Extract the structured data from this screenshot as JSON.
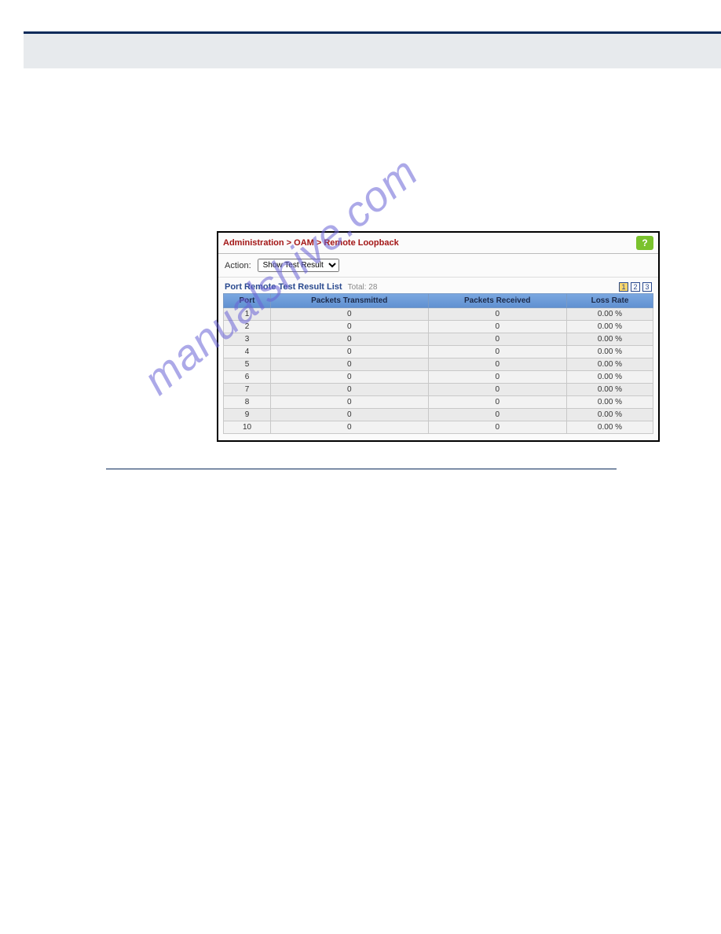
{
  "watermark": "manualshive.com",
  "panel": {
    "breadcrumb": "Administration > OAM > Remote Loopback",
    "help_symbol": "?",
    "action_label": "Action:",
    "action_value": "Show Test Result",
    "list_title": "Port Remote Test Result List",
    "list_total_label": "Total: 28",
    "pager": {
      "pages": [
        "1",
        "2",
        "3"
      ],
      "active_index": 0
    },
    "columns": [
      "Port",
      "Packets Transmitted",
      "Packets Received",
      "Loss Rate"
    ],
    "rows": [
      {
        "port": "1",
        "tx": "0",
        "rx": "0",
        "rate": "0.00 %"
      },
      {
        "port": "2",
        "tx": "0",
        "rx": "0",
        "rate": "0.00 %"
      },
      {
        "port": "3",
        "tx": "0",
        "rx": "0",
        "rate": "0.00 %"
      },
      {
        "port": "4",
        "tx": "0",
        "rx": "0",
        "rate": "0.00 %"
      },
      {
        "port": "5",
        "tx": "0",
        "rx": "0",
        "rate": "0.00 %"
      },
      {
        "port": "6",
        "tx": "0",
        "rx": "0",
        "rate": "0.00 %"
      },
      {
        "port": "7",
        "tx": "0",
        "rx": "0",
        "rate": "0.00 %"
      },
      {
        "port": "8",
        "tx": "0",
        "rx": "0",
        "rate": "0.00 %"
      },
      {
        "port": "9",
        "tx": "0",
        "rx": "0",
        "rate": "0.00 %"
      },
      {
        "port": "10",
        "tx": "0",
        "rx": "0",
        "rate": "0.00 %"
      }
    ]
  }
}
